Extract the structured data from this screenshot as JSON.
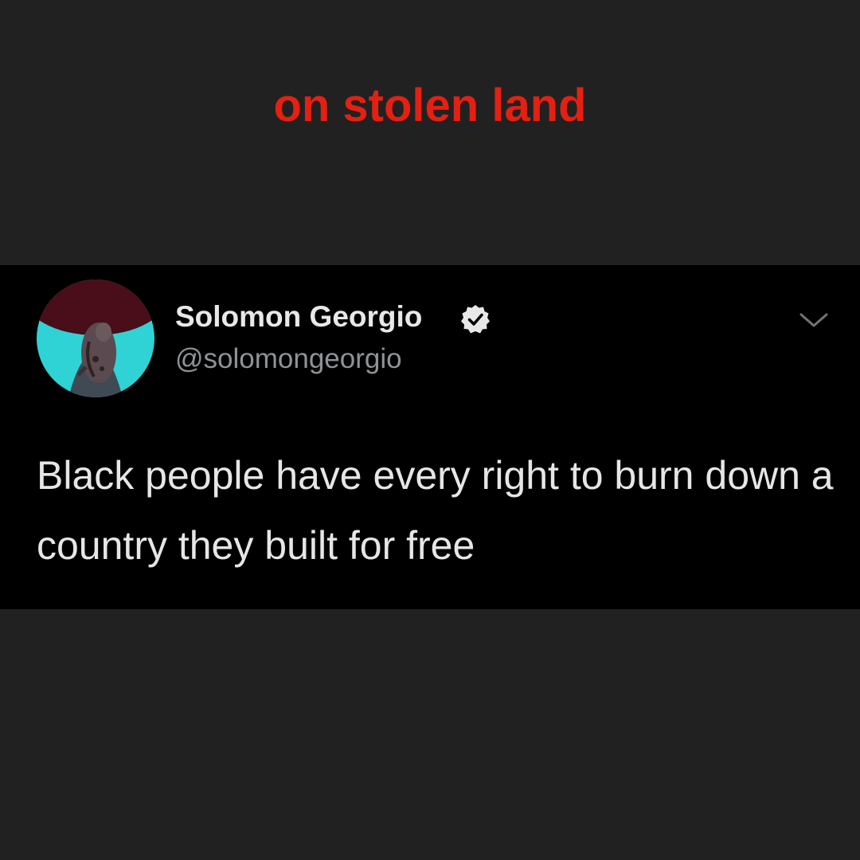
{
  "caption": {
    "text": "on stolen land",
    "color": "#e32012"
  },
  "tweet": {
    "author": {
      "display_name": "Solomon Georgio",
      "handle": "@solomongeorgio",
      "verified": true,
      "avatar_icon": "profile-photo-avatar"
    },
    "text": "Black people have every right to burn down a country they built for free",
    "menu_icon": "chevron-down-icon"
  },
  "colors": {
    "page_background": "#212121",
    "card_background": "#000000",
    "name_text": "#e8e8e8",
    "handle_text": "#8e9398",
    "avatar_background": "#2fd3d6",
    "avatar_top": "#4a0d1a"
  }
}
